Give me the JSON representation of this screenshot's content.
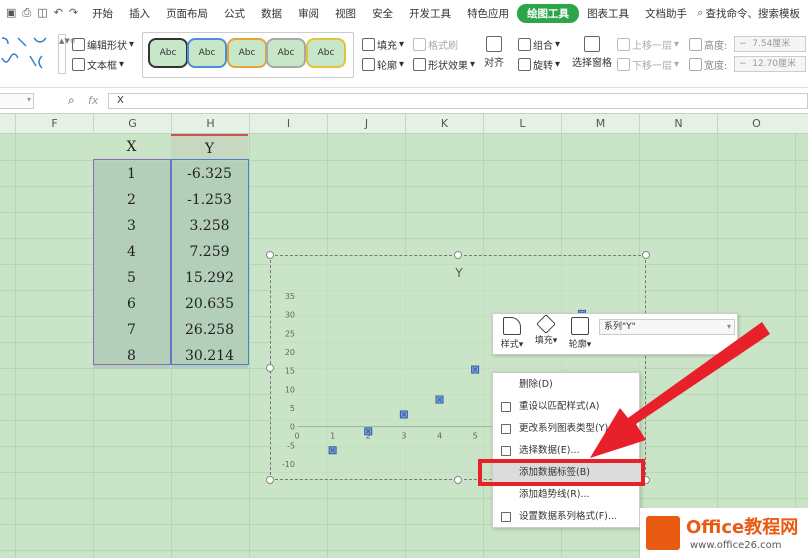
{
  "menubar": {
    "items": [
      "开始",
      "插入",
      "页面布局",
      "公式",
      "数据",
      "审阅",
      "视图",
      "安全",
      "开发工具",
      "特色应用",
      "绘图工具",
      "图表工具",
      "文档助手"
    ],
    "active": "绘图工具",
    "search": "查找命令、搜索模板"
  },
  "ribbon": {
    "edit_shape": "编辑形状",
    "textbox": "文本框",
    "style_label": "Abc",
    "fill": "填充",
    "format_painter": "格式刷",
    "outline": "轮廓",
    "shape_effects": "形状效果",
    "align": "对齐",
    "group": "组合",
    "rotate": "旋转",
    "selection_pane": "选择窗格",
    "bring_forward": "上移一层",
    "send_backward": "下移一层",
    "height_label": "高度:",
    "height_value": "7.54厘米",
    "width_label": "宽度:",
    "width_value": "12.70厘米"
  },
  "formula": {
    "fx": "fx",
    "content": "X"
  },
  "columns": [
    "F",
    "G",
    "H",
    "I",
    "J",
    "K",
    "L",
    "M",
    "N",
    "O"
  ],
  "table": {
    "header_x": "X",
    "header_y": "Y",
    "x": [
      "1",
      "2",
      "3",
      "4",
      "5",
      "6",
      "7",
      "8"
    ],
    "y": [
      "-6.325",
      "-1.253",
      "3.258",
      "7.259",
      "15.292",
      "20.635",
      "26.258",
      "30.214"
    ]
  },
  "chart_data": {
    "type": "scatter",
    "title": "Y",
    "x": [
      1,
      2,
      3,
      4,
      5,
      6,
      7,
      8
    ],
    "y": [
      -6.325,
      -1.253,
      3.258,
      7.259,
      15.292,
      20.635,
      26.258,
      30.214
    ],
    "xticks": [
      "0",
      "1",
      "2",
      "3",
      "4",
      "5"
    ],
    "yticks": [
      "35",
      "30",
      "25",
      "20",
      "15",
      "10",
      "5",
      "0",
      "-5",
      "-10"
    ],
    "xlim": [
      0,
      8
    ],
    "ylim": [
      -10,
      35
    ],
    "marker_color": "#2f5fa8"
  },
  "chart_toolbar": {
    "style": "样式",
    "fill": "填充",
    "outline": "轮廓",
    "series": "系列\"Y\""
  },
  "context_menu": {
    "items": [
      "删除(D)",
      "重设以匹配样式(A)",
      "更改系列图表类型(Y)...",
      "选择数据(E)...",
      "添加数据标签(B)",
      "添加趋势线(R)...",
      "设置数据系列格式(F)..."
    ],
    "highlighted": "添加数据标签(B)"
  },
  "logo": {
    "title": "Office教程网",
    "url": "www.office26.com"
  },
  "colors": {
    "accent": "#2da54a",
    "sheet_bg": "#c9e4c6",
    "highlight": "#e8202a"
  }
}
